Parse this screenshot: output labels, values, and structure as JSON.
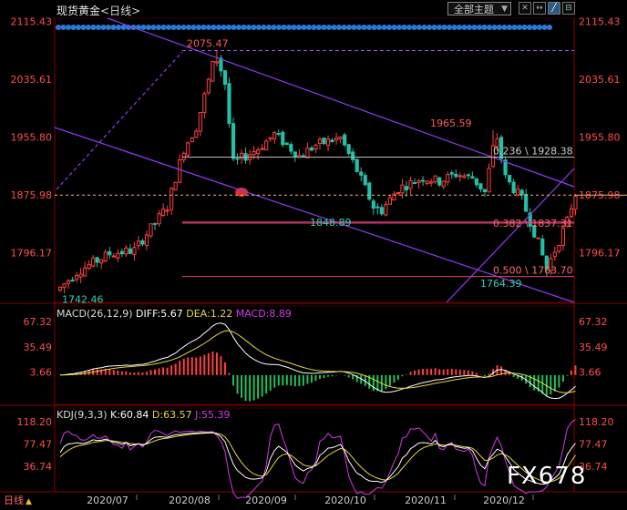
{
  "header": {
    "title": "现货黄金",
    "period": "<日线>",
    "dropdown_label": "全部主题"
  },
  "price_axis": {
    "ticks": [
      "2115.43",
      "2035.61",
      "1955.80",
      "1875.98",
      "1796.17"
    ],
    "tick_values": [
      2115.43,
      2035.61,
      1955.8,
      1875.98,
      1796.17
    ],
    "ylim": [
      1728,
      2120
    ]
  },
  "date_axis": {
    "ticks": [
      "2020/07",
      "2020/08",
      "2020/09",
      "2020/10",
      "2020/11",
      "2020/12"
    ]
  },
  "annotations": {
    "high": "2075.47",
    "low": "1742.46",
    "low2": "1764.39",
    "swing_high": "1965.59",
    "swing_low": "1848.89",
    "fib_0236": "0.236 \\ 1928.38",
    "fib_0382": "0.382 \\ 1837.31",
    "fib_0500": "0.500 \\ 1763.70"
  },
  "macd": {
    "label": "MACD(26,12,9)",
    "diff": "DIFF:5.67",
    "dea": "DEA:1.22",
    "macd": "MACD:8.89",
    "ticks": [
      "67.32",
      "35.49",
      "3.66"
    ],
    "tick_values": [
      67.32,
      35.49,
      3.66
    ]
  },
  "kdj": {
    "label": "KDJ(9,3,3)",
    "k": "K:60.84",
    "d": "D:63.57",
    "j": "J:55.39",
    "ticks": [
      "118.20",
      "77.47",
      "36.74"
    ],
    "tick_values": [
      118.2,
      77.47,
      36.74
    ]
  },
  "watermark": "FX678",
  "bottom_tab": "日线",
  "colors": {
    "up": "#ff4040",
    "down": "#22c0a6",
    "axis_text": "#ff4d4d",
    "channel": "#8b3cf0",
    "macd_diff": "#ffffff",
    "macd_dea": "#e6d53a",
    "kdj_j": "#d33be6"
  },
  "chart_data": {
    "type": "candlestick",
    "instrument": "现货黄金",
    "period": "日线",
    "x": [
      "2020/07",
      "2020/08",
      "2020/09",
      "2020/10",
      "2020/11",
      "2020/12"
    ],
    "ohlc_anchors": [
      {
        "label": "start",
        "close": 1746
      },
      {
        "label": "2020/07 mid",
        "close": 1800
      },
      {
        "label": "late 2020/07",
        "close": 1960
      },
      {
        "label": "peak",
        "high": 2075.47
      },
      {
        "label": "mid 2020/08",
        "close": 1940
      },
      {
        "label": "2020/09",
        "close": 1950
      },
      {
        "label": "late 2020/09",
        "low": 1848.89
      },
      {
        "label": "2020/10",
        "close": 1900
      },
      {
        "label": "early 2020/11",
        "high": 1965.59
      },
      {
        "label": "late 2020/11",
        "low": 1764.39
      },
      {
        "label": "2020/12",
        "close": 1880
      }
    ],
    "lows_labeled": [
      1742.46,
      1764.39,
      1848.89
    ],
    "highs_labeled": [
      2075.47,
      1965.59
    ],
    "fibonacci": [
      {
        "ratio": 0.236,
        "price": 1928.38
      },
      {
        "ratio": 0.382,
        "price": 1837.31
      },
      {
        "ratio": 0.5,
        "price": 1763.7
      }
    ],
    "reference_line": 1875.98,
    "macd_last": {
      "diff": 5.67,
      "dea": 1.22,
      "macd": 8.89
    },
    "kdj_last": {
      "k": 60.84,
      "d": 63.57,
      "j": 55.39
    }
  }
}
